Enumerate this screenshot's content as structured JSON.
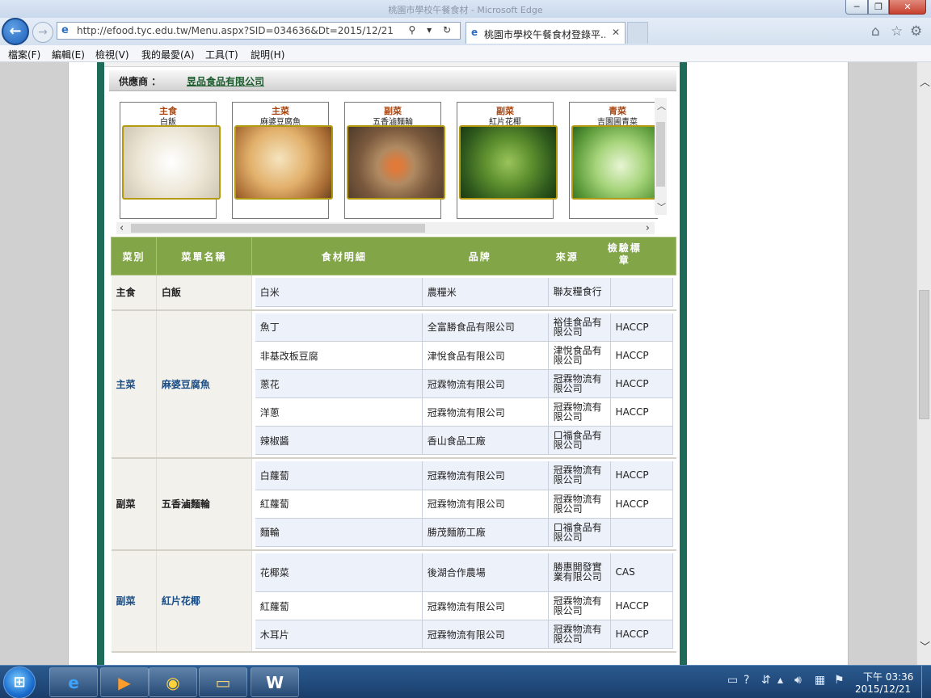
{
  "window": {
    "title": "桃園市學校午餐食材 - Microsoft Edge",
    "min": "─",
    "max": "❐",
    "close": "✕"
  },
  "browser": {
    "back": "←",
    "forward": "→",
    "address_icon": "e",
    "url": "http://efood.tyc.edu.tw/Menu.aspx?SID=034636&Dt=2015/12/21",
    "address_controls": "⚲ ▾ ↻",
    "tab_title": "桃園市學校午餐食材登錄平...",
    "tab_close": "✕",
    "home": "⌂",
    "favorites": "☆",
    "tools": "⚙"
  },
  "menu": [
    "檔案(F)",
    "編輯(E)",
    "檢視(V)",
    "我的最愛(A)",
    "工具(T)",
    "說明(H)"
  ],
  "supplier": {
    "label": "供應商 ：",
    "name": "昱品食品有限公司"
  },
  "gallery": [
    {
      "category": "主食",
      "dish": "白飯",
      "photo": "rice"
    },
    {
      "category": "主菜",
      "dish": "麻婆豆腐魚",
      "photo": "tofu"
    },
    {
      "category": "副菜",
      "dish": "五香滷麵輪",
      "photo": "gluten"
    },
    {
      "category": "副菜",
      "dish": "紅片花椰",
      "photo": "broccoli"
    },
    {
      "category": "青菜",
      "dish": "吉園圃青菜",
      "photo": "greens"
    }
  ],
  "table": {
    "headers": {
      "category": "菜別",
      "dish": "菜單名稱",
      "ingredient": "食材明細",
      "brand": "品牌",
      "source": "來源",
      "verification": "檢驗標章"
    },
    "groups": [
      {
        "category": "主食",
        "dish": "白飯",
        "blue": false,
        "rows": [
          {
            "ingredient": "白米",
            "brand": "農糧米",
            "source": "聯友糧食行",
            "verification": ""
          }
        ]
      },
      {
        "category": "主菜",
        "dish": "麻婆豆腐魚",
        "blue": true,
        "rows": [
          {
            "ingredient": "魚丁",
            "brand": "全富勝食品有限公司",
            "source": "裕佳食品有限公司",
            "verification": "HACCP"
          },
          {
            "ingredient": "非基改板豆腐",
            "brand": "津悅食品有限公司",
            "source": "津悅食品有限公司",
            "verification": "HACCP"
          },
          {
            "ingredient": "蔥花",
            "brand": "冠霖物流有限公司",
            "source": "冠霖物流有限公司",
            "verification": "HACCP"
          },
          {
            "ingredient": "洋蔥",
            "brand": "冠霖物流有限公司",
            "source": "冠霖物流有限公司",
            "verification": "HACCP"
          },
          {
            "ingredient": "辣椒醬",
            "brand": "香山食品工廠",
            "source": "口福食品有限公司",
            "verification": ""
          }
        ]
      },
      {
        "category": "副菜",
        "dish": "五香滷麵輪",
        "blue": false,
        "rows": [
          {
            "ingredient": "白蘿蔔",
            "brand": "冠霖物流有限公司",
            "source": "冠霖物流有限公司",
            "verification": "HACCP"
          },
          {
            "ingredient": "紅蘿蔔",
            "brand": "冠霖物流有限公司",
            "source": "冠霖物流有限公司",
            "verification": "HACCP"
          },
          {
            "ingredient": "麵輪",
            "brand": "勝茂麵筋工廠",
            "source": "口福食品有限公司",
            "verification": ""
          }
        ]
      },
      {
        "category": "副菜",
        "dish": "紅片花椰",
        "blue": true,
        "rows": [
          {
            "ingredient": "花椰菜",
            "brand": "後湖合作農場",
            "source": "勝惠開發實業有限公司",
            "verification": "CAS",
            "tall": true
          },
          {
            "ingredient": "紅蘿蔔",
            "brand": "冠霖物流有限公司",
            "source": "冠霖物流有限公司",
            "verification": "HACCP"
          },
          {
            "ingredient": "木耳片",
            "brand": "冠霖物流有限公司",
            "source": "冠霖物流有限公司",
            "verification": "HACCP"
          }
        ]
      }
    ]
  },
  "taskbar": {
    "start": "⊞",
    "apps": [
      {
        "name": "ie-app",
        "glyph": "e",
        "color": "#3da3ff"
      },
      {
        "name": "media-player-app",
        "glyph": "▶",
        "color": "#ff9c2a"
      },
      {
        "name": "chrome-app",
        "glyph": "◉",
        "color": "#ffd23a"
      },
      {
        "name": "explorer-app",
        "glyph": "▭",
        "color": "#f4d27a"
      },
      {
        "name": "word-app",
        "glyph": "W",
        "color": "#ffffff"
      }
    ],
    "clock_time": "下午 03:36",
    "clock_date": "2015/12/21"
  }
}
